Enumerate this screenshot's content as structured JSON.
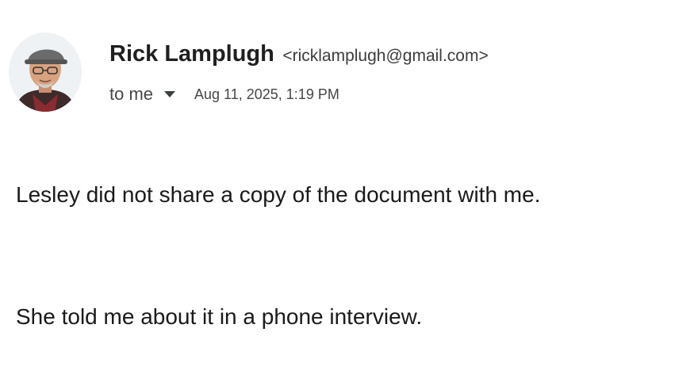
{
  "sender": {
    "avatar_icon": "person-avatar-icon",
    "name": "Rick Lamplugh",
    "email": "<ricklamplugh@gmail.com>"
  },
  "meta": {
    "recipient": "to me",
    "recipient_toggle_icon": "caret-down-icon",
    "timestamp": "Aug 11, 2025, 1:19 PM"
  },
  "body": {
    "lines": [
      "Lesley did not share a copy of the document with me.",
      "She told me about it in a phone interview."
    ]
  },
  "colors": {
    "text": "#1f1f1f",
    "meta_text": "#444746"
  }
}
